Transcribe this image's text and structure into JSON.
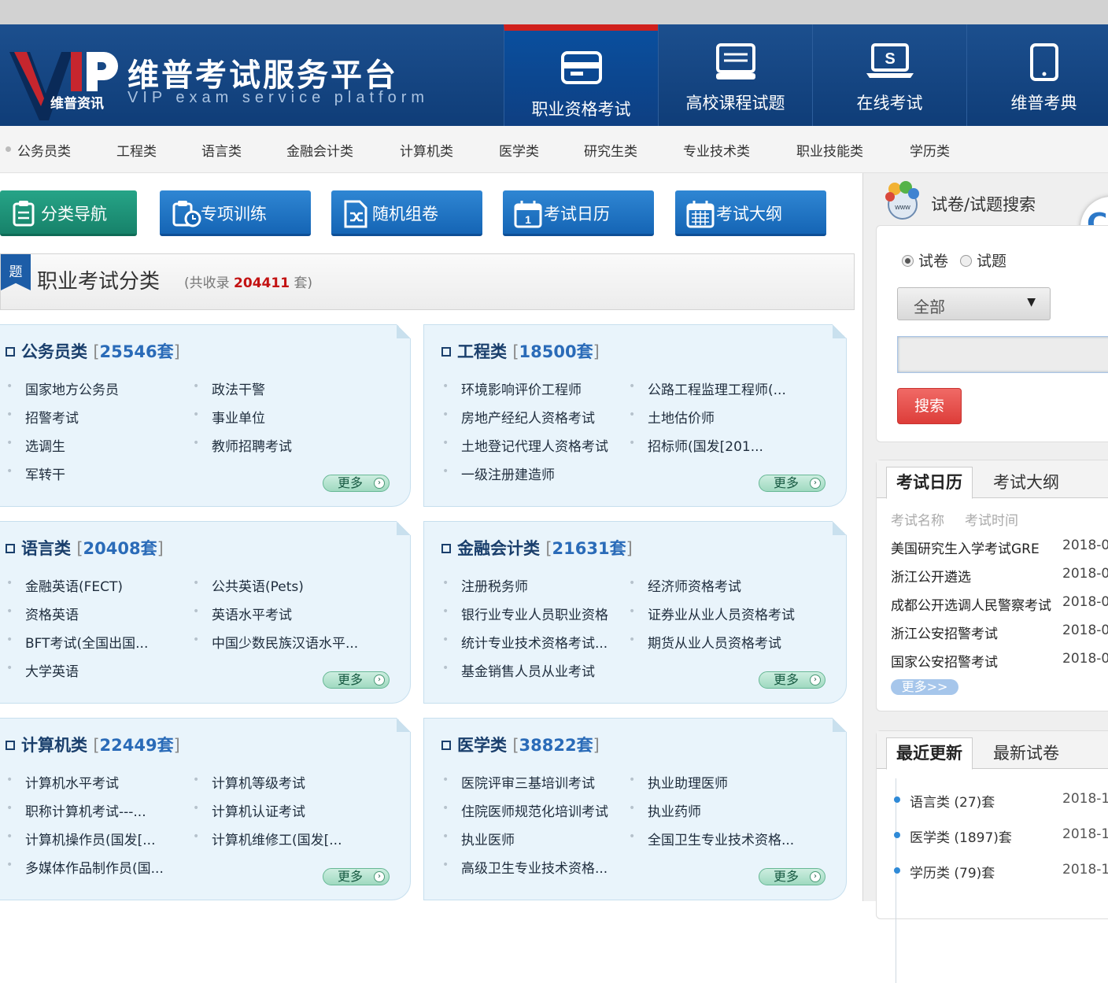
{
  "header": {
    "site_title": "维普考试服务平台",
    "site_subtitle": "VIP exam service platform",
    "logo_text": "维普资讯",
    "logo_mark": "VIP",
    "nav_tabs": [
      {
        "label": "职业资格考试",
        "icon": "card-icon",
        "active": true
      },
      {
        "label": "高校课程试题",
        "icon": "monitor-icon",
        "active": false
      },
      {
        "label": "在线考试",
        "icon": "laptop-icon",
        "active": false
      },
      {
        "label": "维普考典",
        "icon": "tablet-icon",
        "active": false
      }
    ]
  },
  "subnav": [
    "公务员类",
    "工程类",
    "语言类",
    "金融会计类",
    "计算机类",
    "医学类",
    "研究生类",
    "专业技术类",
    "职业技能类",
    "学历类"
  ],
  "toolbar": [
    {
      "label": "分类导航",
      "icon": "clipboard-icon"
    },
    {
      "label": "专项训练",
      "icon": "clipboard-clock-icon"
    },
    {
      "label": "随机组卷",
      "icon": "shuffle-doc-icon"
    },
    {
      "label": "考试日历",
      "icon": "calendar-icon"
    },
    {
      "label": "考试大纲",
      "icon": "grid-calendar-icon"
    }
  ],
  "category_header": {
    "flag": "题",
    "title": "职业考试分类",
    "count_prefix": "(共收录",
    "count": "204411",
    "count_suffix": "套)"
  },
  "panels": [
    {
      "name": "公务员类",
      "count": "25546套",
      "items": [
        "国家地方公务员",
        "政法干警",
        "招警考试",
        "事业单位",
        "选调生",
        "教师招聘考试",
        "军转干"
      ],
      "more": "更多"
    },
    {
      "name": "工程类",
      "count": "18500套",
      "items": [
        "环境影响评价工程师",
        "公路工程监理工程师(...",
        "房地产经纪人资格考试",
        "土地估价师",
        "土地登记代理人资格考试",
        "招标师(国发[201...",
        "一级注册建造师"
      ],
      "more": "更多"
    },
    {
      "name": "语言类",
      "count": "20408套",
      "items": [
        "金融英语(FECT)",
        "公共英语(Pets)",
        "资格英语",
        "英语水平考试",
        "BFT考试(全国出国...",
        "中国少数民族汉语水平...",
        "大学英语"
      ],
      "more": "更多"
    },
    {
      "name": "金融会计类",
      "count": "21631套",
      "items": [
        "注册税务师",
        "经济师资格考试",
        "银行业专业人员职业资格",
        "证券业从业人员资格考试",
        "统计专业技术资格考试...",
        "期货从业人员资格考试",
        "基金销售人员从业考试"
      ],
      "more": "更多"
    },
    {
      "name": "计算机类",
      "count": "22449套",
      "items": [
        "计算机水平考试",
        "计算机等级考试",
        "职称计算机考试---...",
        "计算机认证考试",
        "计算机操作员(国发[...",
        "计算机维修工(国发[...",
        "多媒体作品制作员(国..."
      ],
      "more": "更多"
    },
    {
      "name": "医学类",
      "count": "38822套",
      "items": [
        "医院评审三基培训考试",
        "执业助理医师",
        "住院医师规范化培训考试",
        "执业药师",
        "执业医师",
        "全国卫生专业技术资格...",
        "高级卫生专业技术资格..."
      ],
      "more": "更多"
    }
  ],
  "search": {
    "title": "试卷/试题搜索",
    "radio_paper": "试卷",
    "radio_question": "试题",
    "radio_selected": "试卷",
    "select_value": "全部",
    "input_value": "",
    "button": "搜索"
  },
  "calendar": {
    "tab_active": "考试日历",
    "tab_other": "考试大纲",
    "col_name": "考试名称",
    "col_time": "考试时间",
    "rows": [
      {
        "name": "美国研究生入学考试GRE",
        "date": "2018-0"
      },
      {
        "name": "浙江公开遴选",
        "date": "2018-0"
      },
      {
        "name": "成都公开选调人民警察考试",
        "date": "2018-0"
      },
      {
        "name": "浙江公安招警考试",
        "date": "2018-0"
      },
      {
        "name": "国家公安招警考试",
        "date": "2018-0"
      }
    ],
    "more": "更多>>"
  },
  "updates": {
    "tab_active": "最近更新",
    "tab_other": "最新试卷",
    "rows": [
      {
        "label": "语言类 (27)套",
        "date": "2018-1"
      },
      {
        "label": "医学类 (1897)套",
        "date": "2018-1"
      },
      {
        "label": "学历类 (79)套",
        "date": "2018-1"
      }
    ]
  },
  "colors": {
    "header_blue": "#0f3d78",
    "active_tab_red": "#d0201c",
    "button_blue": "#1565b5",
    "button_green": "#17826a",
    "count_red": "#c31313",
    "search_red": "#dd3d39"
  }
}
